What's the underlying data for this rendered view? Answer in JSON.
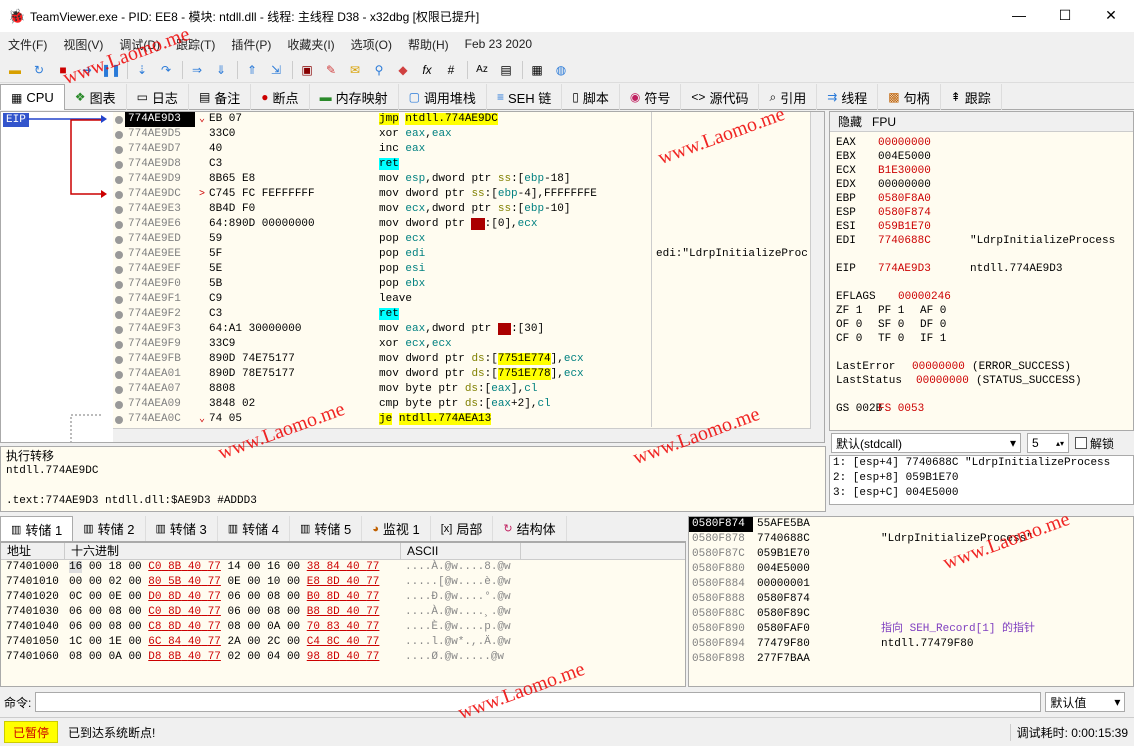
{
  "window": {
    "title": "TeamViewer.exe - PID: EE8 - 模块: ntdll.dll - 线程: 主线程 D38 - x32dbg [权限已提升]"
  },
  "menu": [
    "文件(F)",
    "视图(V)",
    "调试(D)",
    "跟踪(T)",
    "插件(P)",
    "收藏夹(I)",
    "选项(O)",
    "帮助(H)",
    "Feb 23 2020"
  ],
  "tabs": [
    {
      "label": "CPU",
      "icon": "cpu-icon"
    },
    {
      "label": "图表",
      "icon": "graph-icon"
    },
    {
      "label": "日志",
      "icon": "log-icon"
    },
    {
      "label": "备注",
      "icon": "notes-icon"
    },
    {
      "label": "断点",
      "icon": "breakpoint-icon"
    },
    {
      "label": "内存映射",
      "icon": "memory-icon"
    },
    {
      "label": "调用堆栈",
      "icon": "callstack-icon"
    },
    {
      "label": "SEH 链",
      "icon": "seh-icon"
    },
    {
      "label": "脚本",
      "icon": "script-icon"
    },
    {
      "label": "符号",
      "icon": "symbol-icon"
    },
    {
      "label": "源代码",
      "icon": "source-icon"
    },
    {
      "label": "引用",
      "icon": "reference-icon"
    },
    {
      "label": "线程",
      "icon": "thread-icon"
    },
    {
      "label": "句柄",
      "icon": "handle-icon"
    },
    {
      "label": "跟踪",
      "icon": "trace-icon"
    }
  ],
  "eip_label": "EIP",
  "disasm": [
    {
      "addr": "774AE9D3",
      "jmp": "⌄",
      "bytes": "EB 07",
      "instr": "jmp ntdll.774AE9DC",
      "cmt": "",
      "cur": true
    },
    {
      "addr": "774AE9D5",
      "jmp": "",
      "bytes": "33C0",
      "instr": "xor eax,eax",
      "cmt": ""
    },
    {
      "addr": "774AE9D7",
      "jmp": "",
      "bytes": "40",
      "instr": "inc eax",
      "cmt": ""
    },
    {
      "addr": "774AE9D8",
      "jmp": "",
      "bytes": "C3",
      "instr": "ret",
      "cmt": ""
    },
    {
      "addr": "774AE9D9",
      "jmp": "",
      "bytes": "8B65 E8",
      "instr": "mov esp,dword ptr ss:[ebp-18]",
      "cmt": ""
    },
    {
      "addr": "774AE9DC",
      "jmp": "&gt;",
      "bytes": "C745 FC FEFFFFFF",
      "instr": "mov dword ptr ss:[ebp-4],FFFFFFFE",
      "cmt": ""
    },
    {
      "addr": "774AE9E3",
      "jmp": "",
      "bytes": "8B4D F0",
      "instr": "mov ecx,dword ptr ss:[ebp-10]",
      "cmt": ""
    },
    {
      "addr": "774AE9E6",
      "jmp": "",
      "bytes": "64:890D 00000000",
      "instr": "mov dword ptr fs:[0],ecx",
      "cmt": ""
    },
    {
      "addr": "774AE9ED",
      "jmp": "",
      "bytes": "59",
      "instr": "pop ecx",
      "cmt": ""
    },
    {
      "addr": "774AE9EE",
      "jmp": "",
      "bytes": "5F",
      "instr": "pop edi",
      "cmt": "edi:\"LdrpInitializeProc"
    },
    {
      "addr": "774AE9EF",
      "jmp": "",
      "bytes": "5E",
      "instr": "pop esi",
      "cmt": ""
    },
    {
      "addr": "774AE9F0",
      "jmp": "",
      "bytes": "5B",
      "instr": "pop ebx",
      "cmt": ""
    },
    {
      "addr": "774AE9F1",
      "jmp": "",
      "bytes": "C9",
      "instr": "leave",
      "cmt": ""
    },
    {
      "addr": "774AE9F2",
      "jmp": "",
      "bytes": "C3",
      "instr": "ret",
      "cmt": ""
    },
    {
      "addr": "774AE9F3",
      "jmp": "",
      "bytes": "64:A1 30000000",
      "instr": "mov eax,dword ptr fs:[30]",
      "cmt": ""
    },
    {
      "addr": "774AE9F9",
      "jmp": "",
      "bytes": "33C9",
      "instr": "xor ecx,ecx",
      "cmt": ""
    },
    {
      "addr": "774AE9FB",
      "jmp": "",
      "bytes": "890D 74E75177",
      "instr": "mov dword ptr ds:[7751E774],ecx",
      "cmt": ""
    },
    {
      "addr": "774AEA01",
      "jmp": "",
      "bytes": "890D 78E75177",
      "instr": "mov dword ptr ds:[7751E778],ecx",
      "cmt": ""
    },
    {
      "addr": "774AEA07",
      "jmp": "",
      "bytes": "8808",
      "instr": "mov byte ptr ds:[eax],cl",
      "cmt": ""
    },
    {
      "addr": "774AEA09",
      "jmp": "",
      "bytes": "3848 02",
      "instr": "cmp byte ptr ds:[eax+2],cl",
      "cmt": ""
    },
    {
      "addr": "774AEA0C",
      "jmp": "⌄",
      "bytes": "74 05",
      "instr": "je ntdll.774AEA13",
      "cmt": ""
    }
  ],
  "reg_header": {
    "hide": "隐藏",
    "fpu": "FPU"
  },
  "registers": [
    {
      "n": "EAX",
      "v": "00000000",
      "s": ""
    },
    {
      "n": "EBX",
      "v": "004E5000",
      "s": "",
      "blk": true
    },
    {
      "n": "ECX",
      "v": "B1E30000",
      "s": ""
    },
    {
      "n": "EDX",
      "v": "00000000",
      "s": "",
      "blk": true
    },
    {
      "n": "EBP",
      "v": "0580F8A0",
      "s": ""
    },
    {
      "n": "ESP",
      "v": "0580F874",
      "s": ""
    },
    {
      "n": "ESI",
      "v": "059B1E70",
      "s": ""
    },
    {
      "n": "EDI",
      "v": "7740688C",
      "s": "\"LdrpInitializeProcess"
    },
    {
      "n": "",
      "v": "",
      "s": ""
    },
    {
      "n": "EIP",
      "v": "774AE9D3",
      "s": "ntdll.774AE9D3"
    },
    {
      "n": "",
      "v": "",
      "s": ""
    },
    {
      "n": "EFLAGS",
      "v": "00000246",
      "s": ""
    },
    {
      "n": "ZF 1",
      "v": "PF 1",
      "s": "AF 0"
    },
    {
      "n": "OF 0",
      "v": "SF 0",
      "s": "DF 0"
    },
    {
      "n": "CF 0",
      "v": "TF 0",
      "s": "IF 1"
    },
    {
      "n": "",
      "v": "",
      "s": ""
    },
    {
      "n": "LastError",
      "v": "00000000",
      "s": "(ERROR_SUCCESS)"
    },
    {
      "n": "LastStatus",
      "v": "00000000",
      "s": "(STATUS_SUCCESS)"
    },
    {
      "n": "",
      "v": "",
      "s": ""
    },
    {
      "n": "GS 002B",
      "v": "FS 0053",
      "s": ""
    }
  ],
  "callconv": {
    "value": "默认(stdcall)",
    "arg_count": "5",
    "lock_label": "解锁"
  },
  "args": [
    "1: [esp+4] 7740688C \"LdrpInitializeProcess",
    "2: [esp+8] 059B1E70",
    "3: [esp+C] 004E5000"
  ],
  "info": {
    "line1": "执行转移",
    "line2": "ntdll.774AE9DC",
    "line3": "",
    "line4": ".text:774AE9D3 ntdll.dll:$AE9D3 #ADDD3"
  },
  "dump_tabs": [
    "转储 1",
    "转储 2",
    "转储 3",
    "转储 4",
    "转储 5",
    "监视 1",
    "局部",
    "结构体"
  ],
  "dump_header": {
    "addr": "地址",
    "hex": "十六进制",
    "ascii": "ASCII"
  },
  "dump_rows": [
    {
      "a": "77401000",
      "h": "16 00 18 00 C0 8B 40 77 14 00 16 00 38 84 40 77",
      "s": "....À.@w....8.@w"
    },
    {
      "a": "77401010",
      "h": "00 00 02 00 80 5B 40 77 0E 00 10 00 E8 8D 40 77",
      "s": ".....[@w....è.@w"
    },
    {
      "a": "77401020",
      "h": "0C 00 0E 00 D0 8D 40 77 06 00 08 00 B0 8D 40 77",
      "s": "....Ð.@w....°.@w"
    },
    {
      "a": "77401030",
      "h": "06 00 08 00 C0 8D 40 77 06 00 08 00 B8 8D 40 77",
      "s": "....À.@w....¸.@w"
    },
    {
      "a": "77401040",
      "h": "06 00 08 00 C8 8D 40 77 08 00 0A 00 70 83 40 77",
      "s": "....È.@w....p.@w"
    },
    {
      "a": "77401050",
      "h": "1C 00 1E 00 6C 84 40 77 2A 00 2C 00 C4 8C 40 77",
      "s": "....l.@w*.,.Ä.@w"
    },
    {
      "a": "77401060",
      "h": "08 00 0A 00 D8 8B 40 77 02 00 04 00 98 8D 40 77",
      "s": "....Ø.@w.....@w"
    }
  ],
  "stack_rows": [
    {
      "a": "0580F874",
      "v": "55AFE5BA",
      "c": "",
      "cur": true
    },
    {
      "a": "0580F878",
      "v": "7740688C",
      "c": "\"LdrpInitializeProcess\""
    },
    {
      "a": "0580F87C",
      "v": "059B1E70",
      "c": ""
    },
    {
      "a": "0580F880",
      "v": "004E5000",
      "c": ""
    },
    {
      "a": "0580F884",
      "v": "00000001",
      "c": ""
    },
    {
      "a": "0580F888",
      "v": "0580F874",
      "c": ""
    },
    {
      "a": "0580F88C",
      "v": "0580F89C",
      "c": ""
    },
    {
      "a": "0580F890",
      "v": "0580FAF0",
      "c": "指向 SEH_Record[1] 的指针",
      "purple": true
    },
    {
      "a": "0580F894",
      "v": "77479F80",
      "c": "ntdll.77479F80"
    },
    {
      "a": "0580F898",
      "v": "277F7BAA",
      "c": ""
    }
  ],
  "cmd": {
    "label": "命令:",
    "default": "默认值"
  },
  "status": {
    "paused": "已暂停",
    "message": "已到达系统断点!",
    "time_label": "调试耗时:",
    "time": "0:00:15:39"
  },
  "watermark": "www.Laomo.me",
  "colors": {
    "eip_tag": "#3355cc",
    "paused_bg": "#ffff00",
    "paused_fg": "#cc0000",
    "jump_arrow": "#cc0000"
  }
}
